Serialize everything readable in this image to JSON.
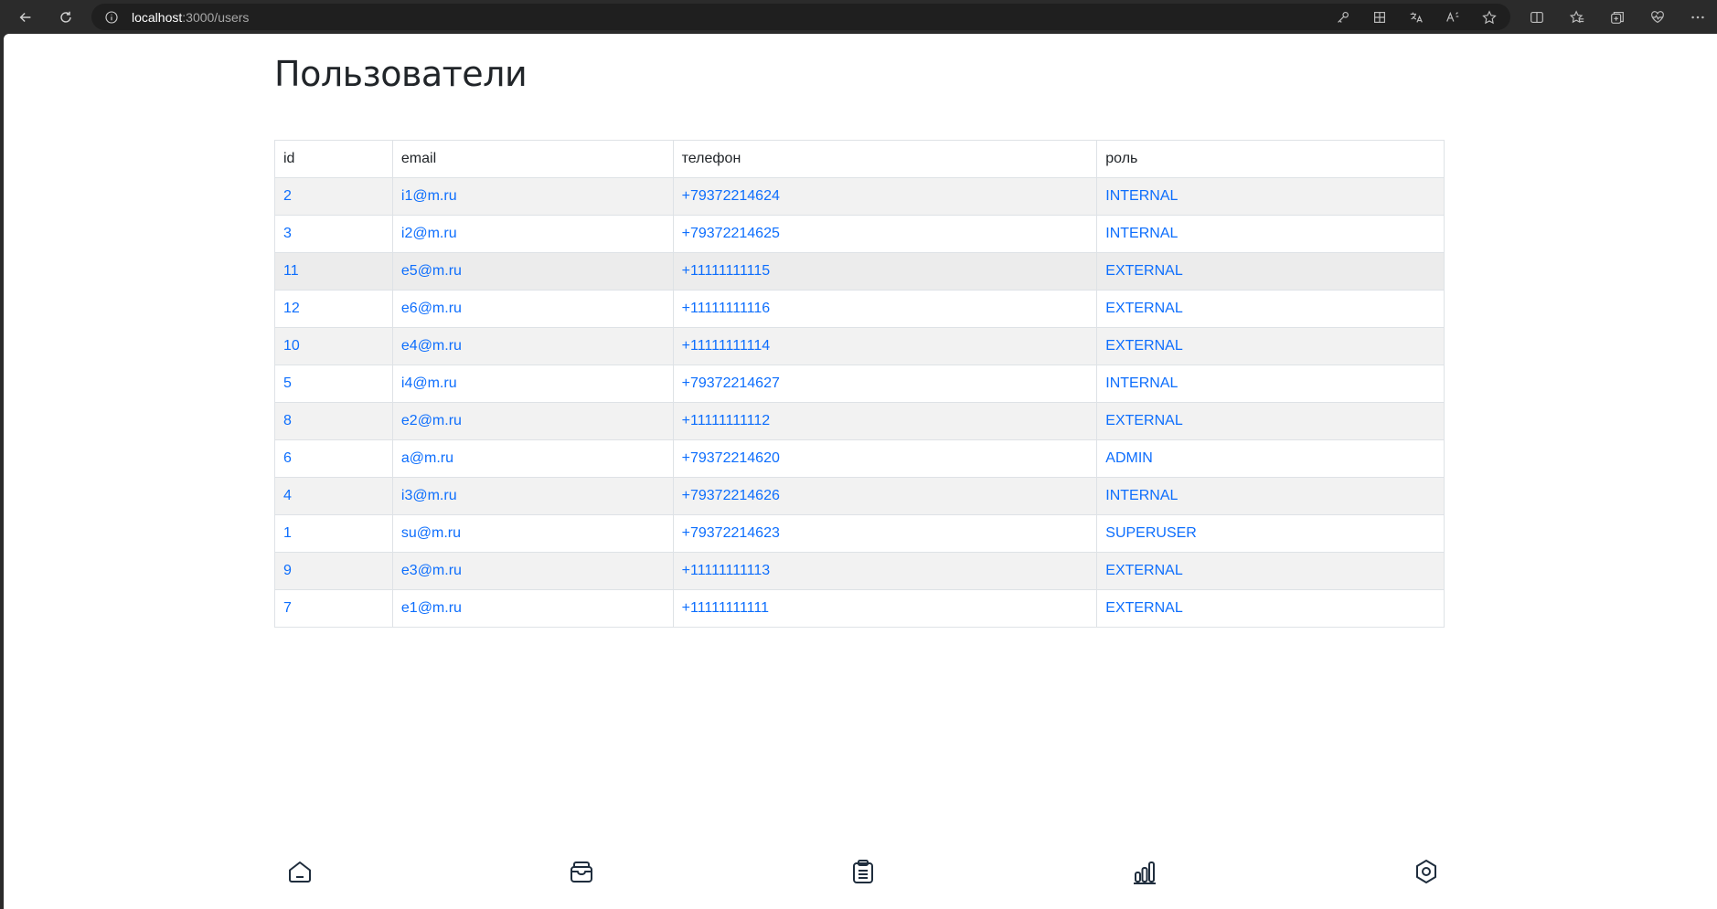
{
  "browser": {
    "url_host": "localhost",
    "url_path": ":3000/users",
    "icons": [
      "back-icon",
      "reload-icon",
      "info-icon",
      "key-icon",
      "apps-icon",
      "translate-icon",
      "read-aloud-icon",
      "star-icon",
      "split-screen-icon",
      "favorites-icon",
      "collections-icon",
      "health-icon",
      "more-icon"
    ]
  },
  "page": {
    "title": "Пользователи"
  },
  "table": {
    "headers": [
      "id",
      "email",
      "телефон",
      "роль"
    ],
    "rows": [
      [
        "2",
        "i1@m.ru",
        "+79372214624",
        "INTERNAL"
      ],
      [
        "3",
        "i2@m.ru",
        "+79372214625",
        "INTERNAL"
      ],
      [
        "11",
        "e5@m.ru",
        "+11111111115",
        "EXTERNAL"
      ],
      [
        "12",
        "e6@m.ru",
        "+11111111116",
        "EXTERNAL"
      ],
      [
        "10",
        "e4@m.ru",
        "+11111111114",
        "EXTERNAL"
      ],
      [
        "5",
        "i4@m.ru",
        "+79372214627",
        "INTERNAL"
      ],
      [
        "8",
        "e2@m.ru",
        "+11111111112",
        "EXTERNAL"
      ],
      [
        "6",
        "a@m.ru",
        "+79372214620",
        "ADMIN"
      ],
      [
        "4",
        "i3@m.ru",
        "+79372214626",
        "INTERNAL"
      ],
      [
        "1",
        "su@m.ru",
        "+79372214623",
        "SUPERUSER"
      ],
      [
        "9",
        "e3@m.ru",
        "+11111111113",
        "EXTERNAL"
      ],
      [
        "7",
        "e1@m.ru",
        "+11111111111",
        "EXTERNAL"
      ]
    ]
  },
  "bottom_nav": {
    "items": [
      "home-icon",
      "inbox-icon",
      "clipboard-list-icon",
      "chart-bars-icon",
      "settings-icon"
    ]
  },
  "colors": {
    "link": "#0d6efd",
    "text": "#212529",
    "stripe": "#f2f2f2",
    "border": "#dee2e6"
  }
}
